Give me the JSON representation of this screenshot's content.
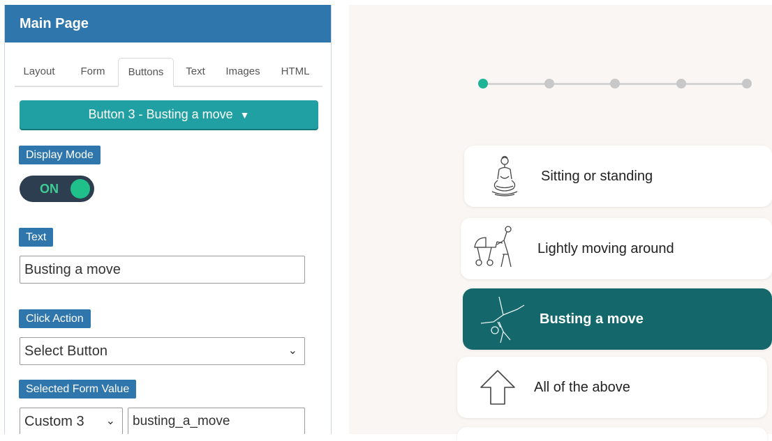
{
  "panel": {
    "title": "Main Page",
    "tabs": [
      "Layout",
      "Form",
      "Buttons",
      "Text",
      "Images",
      "HTML"
    ],
    "active_tab": "Buttons",
    "button_selector": {
      "label": "Button 3 - Busting a move",
      "caret": "▼"
    },
    "display_mode": {
      "label": "Display Mode",
      "state": "ON"
    },
    "text_field": {
      "label": "Text",
      "value": "Busting a move"
    },
    "click_action": {
      "label": "Click Action",
      "value": "Select Button",
      "arrow": "⌄"
    },
    "selected_form_value": {
      "label": "Selected Form Value",
      "select_value": "Custom 3",
      "arrow": "⌄",
      "input_value": "busting_a_move"
    }
  },
  "preview": {
    "progress": {
      "total_steps": 5,
      "current_step": 1
    },
    "options": [
      {
        "label": "Sitting or standing",
        "icon": "meditation-icon",
        "selected": false
      },
      {
        "label": "Lightly moving around",
        "icon": "stroller-walk-icon",
        "selected": false
      },
      {
        "label": "Busting a move",
        "icon": "cartwheel-icon",
        "selected": true
      },
      {
        "label": "All of the above",
        "icon": "arrow-up-icon",
        "selected": false
      }
    ]
  },
  "colors": {
    "header_blue": "#2f76ad",
    "teal_button": "#20a0a3",
    "toggle_bg": "#2c3e50",
    "toggle_knob": "#20c08b",
    "selected_option": "#14686b",
    "progress_active": "#1fb497"
  }
}
